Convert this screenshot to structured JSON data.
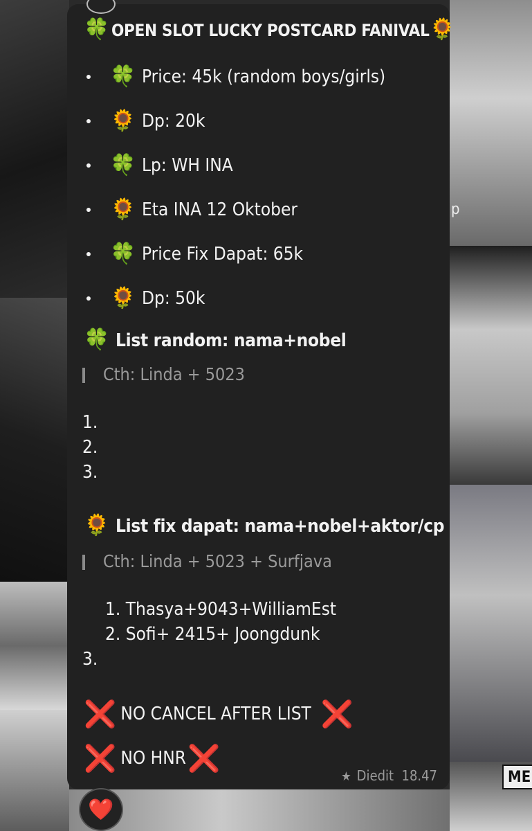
{
  "message": {
    "title": "OPEN SLOT LUCKY POSTCARD FANIVAL",
    "title_lead_icon": "🍀",
    "title_trail_icon": "🌻",
    "bullets": [
      {
        "icon": "🍀",
        "text": "Price: 45k (random boys/girls)"
      },
      {
        "icon": "🌻",
        "text": "Dp: 20k"
      },
      {
        "icon": "🍀",
        "text": "Lp: WH INA"
      },
      {
        "icon": "🌻",
        "text": "Eta INA 12 Oktober"
      },
      {
        "icon": "🍀",
        "text": "Price Fix Dapat: 65k"
      },
      {
        "icon": "🌻",
        "text": "Dp: 50k"
      }
    ],
    "random_list": {
      "icon": "🍀",
      "heading": "List random: nama+nobel",
      "example": "Cth: Linda + 5023",
      "items": [
        "1.",
        "2.",
        "3."
      ]
    },
    "fix_list": {
      "icon": "🌻",
      "heading": "List fix dapat: nama+nobel+aktor/cp",
      "example": "Cth: Linda + 5023 + Surfjava",
      "items": [
        "1. Thasya+9043+WilliamEst",
        "2. Sofi+ 2415+ Joongdunk"
      ],
      "last_item": "3."
    },
    "warnings": [
      {
        "icon": "❌",
        "text": "NO CANCEL AFTER LIST",
        "trail_icon": "❌"
      },
      {
        "icon": "❌",
        "text": "NO HNR",
        "trail_icon": "❌"
      }
    ],
    "edited_label": "Diedit",
    "time": "18.47"
  },
  "reaction": {
    "emoji": "❤️"
  },
  "colors": {
    "bubble": "#212121",
    "text": "#f2f2f2",
    "muted": "#9a9a9a",
    "accent_red": "#e5312c"
  },
  "wallpaper": {
    "visible_letter": "p",
    "tag_text": "ME"
  }
}
